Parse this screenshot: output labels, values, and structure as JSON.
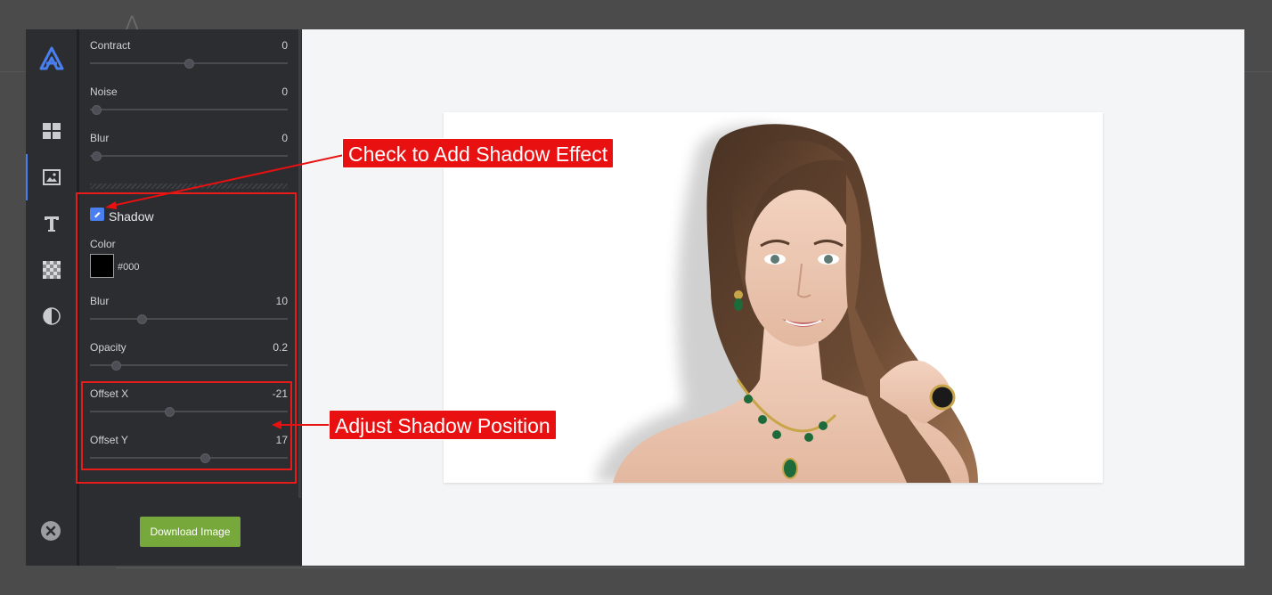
{
  "sidebar": {
    "rail_icons": [
      "logo-icon",
      "layout-icon",
      "image-icon",
      "text-icon",
      "transparency-icon",
      "contrast-icon",
      "close-icon"
    ],
    "sliders_top": [
      {
        "label": "Contract",
        "value": "0",
        "fraction": 0.5
      },
      {
        "label": "Noise",
        "value": "0",
        "fraction": 0.03
      },
      {
        "label": "Blur",
        "value": "0",
        "fraction": 0.03
      }
    ],
    "shadow": {
      "title": "Shadow",
      "checked": true,
      "color_label": "Color",
      "color_hex": "#000",
      "sliders": [
        {
          "label": "Blur",
          "value": "10",
          "fraction": 0.26
        },
        {
          "label": "Opacity",
          "value": "0.2",
          "fraction": 0.13
        },
        {
          "label": "Offset X",
          "value": "-21",
          "fraction": 0.4
        },
        {
          "label": "Offset Y",
          "value": "17",
          "fraction": 0.58
        }
      ]
    },
    "download_label": "Download Image"
  },
  "annotations": {
    "check_callout": "Check to Add Shadow Effect",
    "position_callout": "Adjust Shadow Position",
    "color": "#e81010"
  },
  "colors": {
    "accent": "#4a7ff0",
    "download": "#76a83b",
    "panel": "#2b2d30"
  }
}
